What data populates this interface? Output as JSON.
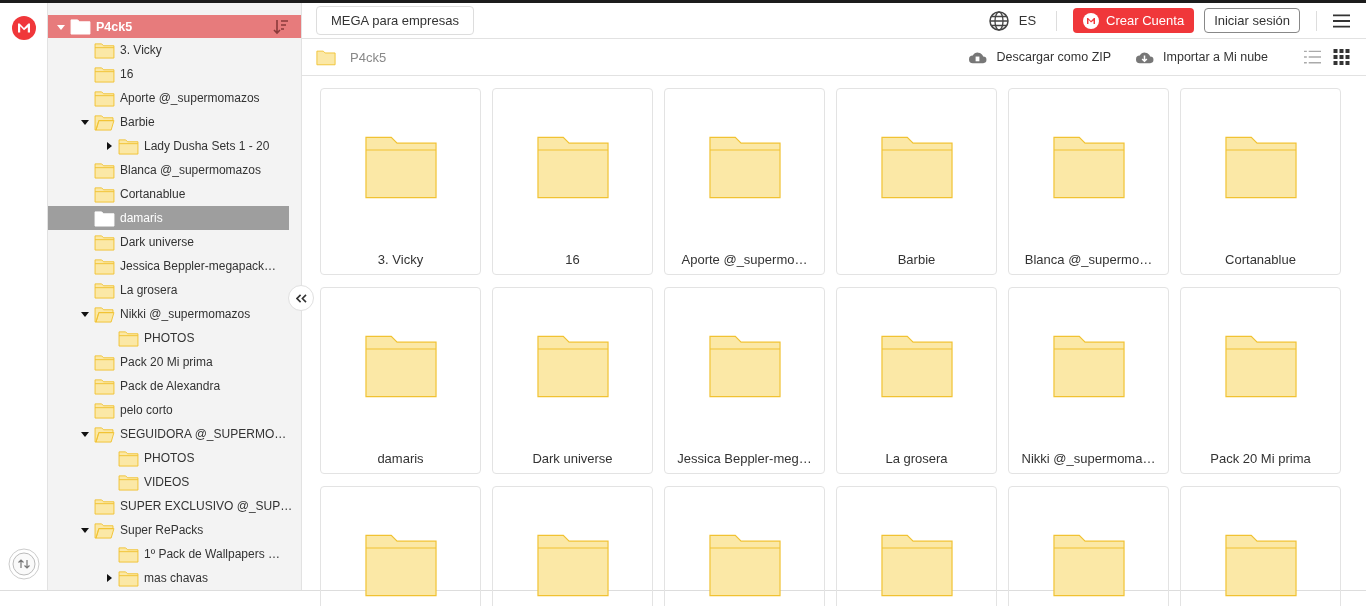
{
  "sidebar": {
    "root": {
      "label": "P4ck5"
    },
    "items": [
      {
        "label": "3. Vicky",
        "kind": "leaf",
        "selected": false
      },
      {
        "label": "16",
        "kind": "leaf",
        "selected": false
      },
      {
        "label": "Aporte @_supermomazos",
        "kind": "leaf",
        "selected": false
      },
      {
        "label": "Barbie",
        "kind": "expanded",
        "selected": false,
        "children": [
          {
            "label": "Lady Dusha Sets 1 - 20",
            "kind": "collapsed",
            "selected": false
          }
        ]
      },
      {
        "label": "Blanca @_supermomazos",
        "kind": "leaf",
        "selected": false
      },
      {
        "label": "Cortanablue",
        "kind": "leaf",
        "selected": false
      },
      {
        "label": "damaris",
        "kind": "leaf",
        "selected": true
      },
      {
        "label": "Dark universe",
        "kind": "leaf",
        "selected": false
      },
      {
        "label": "Jessica Beppler-megapack…",
        "kind": "leaf",
        "selected": false
      },
      {
        "label": "La grosera",
        "kind": "leaf",
        "selected": false
      },
      {
        "label": "Nikki @_supermomazos",
        "kind": "expanded",
        "selected": false,
        "children": [
          {
            "label": "PHOTOS",
            "kind": "leaf",
            "selected": false
          }
        ]
      },
      {
        "label": "Pack 20 Mi prima",
        "kind": "leaf",
        "selected": false
      },
      {
        "label": "Pack de Alexandra",
        "kind": "leaf",
        "selected": false
      },
      {
        "label": "pelo corto",
        "kind": "leaf",
        "selected": false
      },
      {
        "label": "SEGUIDORA @_SUPERMO…",
        "kind": "expanded",
        "selected": false,
        "children": [
          {
            "label": "PHOTOS",
            "kind": "leaf",
            "selected": false
          },
          {
            "label": "VIDEOS",
            "kind": "leaf",
            "selected": false
          }
        ]
      },
      {
        "label": "SUPER EXCLUSIVO @_SUP…",
        "kind": "leaf",
        "selected": false
      },
      {
        "label": "Super RePacks",
        "kind": "expanded",
        "selected": false,
        "children": [
          {
            "label": "1º Pack de Wallpapers …",
            "kind": "leaf",
            "selected": false
          },
          {
            "label": "mas chavas",
            "kind": "collapsed",
            "selected": false
          }
        ]
      }
    ]
  },
  "topbar": {
    "business_button": "MEGA para empresas",
    "language": "ES",
    "create_account": "Crear Cuenta",
    "login": "Iniciar sesión"
  },
  "breadcrumb": {
    "folder": "P4ck5",
    "download_zip": "Descargar como ZIP",
    "import": "Importar a Mi nube",
    "view_modes": [
      {
        "kind": "list",
        "selected": false
      },
      {
        "kind": "grid",
        "selected": true
      }
    ]
  },
  "tiles": [
    {
      "kind": "folder",
      "name": "3. Vicky"
    },
    {
      "kind": "folder",
      "name": "16"
    },
    {
      "kind": "folder",
      "name": "Aporte @_supermo…"
    },
    {
      "kind": "folder",
      "name": "Barbie"
    },
    {
      "kind": "folder",
      "name": "Blanca @_supermo…"
    },
    {
      "kind": "folder",
      "name": "Cortanablue"
    },
    {
      "kind": "folder",
      "name": "damaris"
    },
    {
      "kind": "folder",
      "name": "Dark universe"
    },
    {
      "kind": "folder",
      "name": "Jessica Beppler-meg…"
    },
    {
      "kind": "folder",
      "name": "La grosera"
    },
    {
      "kind": "folder",
      "name": "Nikki @_supermoma…"
    },
    {
      "kind": "folder",
      "name": "Pack 20 Mi prima"
    },
    {
      "kind": "folder"
    },
    {
      "kind": "folder"
    },
    {
      "kind": "folder"
    },
    {
      "kind": "folder"
    },
    {
      "kind": "folder"
    },
    {
      "kind": "folder"
    }
  ]
}
